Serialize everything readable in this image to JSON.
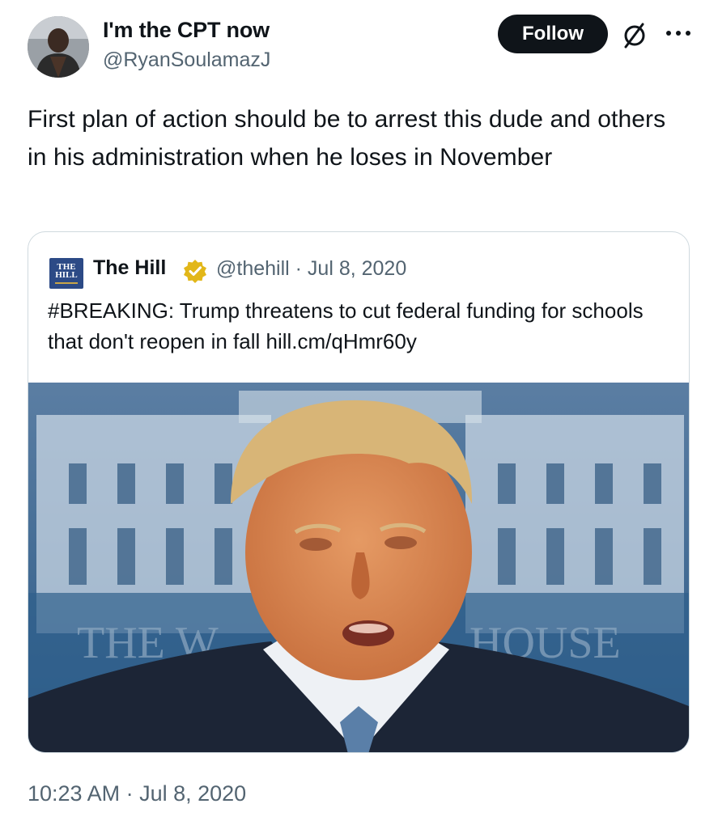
{
  "author": {
    "display_name": "I'm the CPT now",
    "handle": "@RyanSoulamazJ",
    "avatar_icon": "avatar"
  },
  "actions": {
    "follow_label": "Follow",
    "grok_icon": "slashed-circle-icon",
    "more_icon": "more-dots-icon"
  },
  "tweet": {
    "text": "First plan of action should be to arrest this dude and others in his administration when he loses in November",
    "timestamp": "10:23 AM · Jul 8, 2020"
  },
  "quoted": {
    "logo_line1": "THE",
    "logo_line2": "HILL",
    "name": "The Hill",
    "meta": "@thehill · Jul 8, 2020",
    "text": "#BREAKING: Trump threatens to cut federal funding for schools that don't reopen in fall hill.cm/qHmr60y",
    "image_sign_left": "THE W",
    "image_sign_right": "HOUSE"
  },
  "colors": {
    "follow_bg": "#0f1419",
    "secondary_text": "#536471",
    "verified_gold": "#e2b719",
    "card_border": "#cfd9de"
  }
}
